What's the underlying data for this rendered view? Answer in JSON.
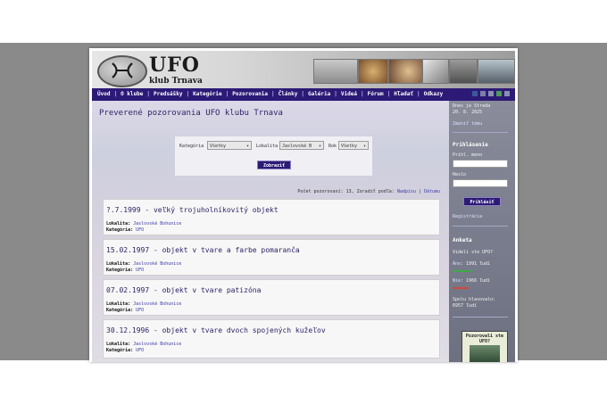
{
  "logo": {
    "title": "UFO",
    "subtitle": "klub Trnava"
  },
  "nav": {
    "items": [
      "Úvod",
      "O klube",
      "Predsášky",
      "Kategórie",
      "Pozorovania",
      "Články",
      "Galéria",
      "Videá",
      "Fórum",
      "Hľadať",
      "Odkazy"
    ],
    "separator": "|",
    "social_colors": [
      "#3b5998",
      "#7a7fa8",
      "#8a8fb0",
      "#4f9a54",
      "#8a8fb0"
    ]
  },
  "main": {
    "title": "Preverené pozorovania UFO klubu Trnava",
    "filter": {
      "category_label": "Kategória",
      "category_value": "Všetky",
      "locality_label": "Lokalita",
      "locality_value": "Jaslovské B",
      "year_label": "Rok",
      "year_value": "Všetky",
      "submit_label": "Zobraziť"
    },
    "count_text": "Počet pozorovaní: 13, Zoradiť podľa:",
    "sort_name": "Nadpisu",
    "sort_sep": "|",
    "sort_date": "Dátumu",
    "meta_labels": {
      "locality": "Lokalita:",
      "category": "Kategória:"
    },
    "observations": [
      {
        "title": "?.7.1999 - veľký trojuholníkovitý objekt",
        "locality": "Jaslovské Bohunice",
        "category": "UFO"
      },
      {
        "title": "15.02.1997 - objekt v tvare a farbe pomaranča",
        "locality": "Jaslovské Bohunice",
        "category": "UFO"
      },
      {
        "title": "07.02.1997 - objekt v tvare patizóna",
        "locality": "Jaslovské Bohunice",
        "category": "UFO"
      },
      {
        "title": "30.12.1996 - objekt v tvare dvoch spojených kužeľov",
        "locality": "Jaslovské Bohunice",
        "category": "UFO"
      }
    ]
  },
  "sidebar": {
    "date_line1": "Dnes je Streda",
    "date_line2": "20. 8. 2025",
    "theme_link": "Zmeniť tému",
    "login_title": "Prihlásenie",
    "username_label": "Prihl. meno",
    "password_label": "Heslo",
    "login_button": "Prihlásiť",
    "register_link": "Registrácia",
    "poll_title": "Anketa",
    "poll_question": "Videli ste UFO?",
    "poll_yes_label": "Áno",
    "poll_yes_value": ": 1991 ľudí",
    "poll_no_label": "Nie",
    "poll_no_value": ": 1966 ľudí",
    "poll_total_line1": "Spolu hlasovalo:",
    "poll_total_line2": "6957 ľudí",
    "ad_text": "Pozorovali ste UFO?"
  }
}
